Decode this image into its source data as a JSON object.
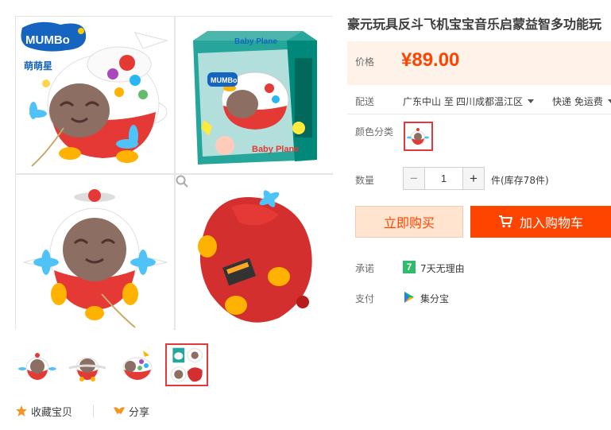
{
  "product": {
    "title": "豪元玩具反斗飞机宝宝音乐启蒙益智多功能玩",
    "brand_logo": "MUMBo",
    "brand_cn": "萌萌星",
    "box_label": "Baby Plane"
  },
  "price": {
    "label": "价格",
    "value": "¥89.00",
    "color": "#ff4400"
  },
  "shipping": {
    "label": "配送",
    "from": "广东中山 至",
    "to": "四川成都温江区",
    "fee": "快递 免运费"
  },
  "color_option": {
    "label": "颜色分类",
    "selected_icon": "plane-swatch"
  },
  "quantity": {
    "label": "数量",
    "minus": "−",
    "value": "1",
    "plus": "+",
    "stock": "件(库存78件)"
  },
  "buttons": {
    "buy_now": "立即购买",
    "add_to_cart": "加入购物车"
  },
  "promise": {
    "label": "承诺",
    "icon_char": "7",
    "text": "7天无理由"
  },
  "payment": {
    "label": "支付",
    "text": "集分宝"
  },
  "actions": {
    "favorite": "收藏宝贝",
    "share": "分享"
  },
  "icons": [
    "zoom-icon",
    "star-icon",
    "share-icon",
    "cart-icon",
    "caret-down-icon",
    "promise-7day-icon",
    "jifenbao-icon"
  ],
  "colors": {
    "accent": "#ff4400",
    "buy_bg": "#ffe4d0",
    "price_bg": "#fff2e8",
    "thumb_selected": "#e4393c"
  }
}
